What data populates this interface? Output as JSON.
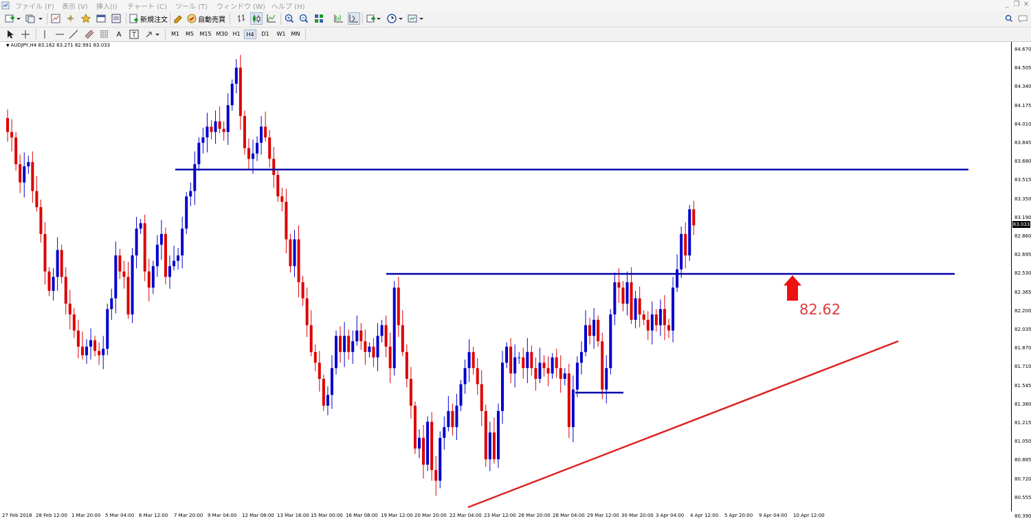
{
  "menu": {
    "items": [
      "ファイル (F)",
      "表示 (V)",
      "挿入(I)",
      "チャート (C)",
      "ツール (T)",
      "ウィンドウ (W)",
      "ヘルプ (H)"
    ]
  },
  "toolbar": {
    "new_order_label": "新規注文",
    "auto_trade_label": "自動売買",
    "timeframes": [
      "M1",
      "M5",
      "M15",
      "M30",
      "H1",
      "H4",
      "D1",
      "W1",
      "MN"
    ],
    "active_timeframe": "H4"
  },
  "chart": {
    "symbol_info": "AUDJPY,H4  83.162 83.271 82.991 83.033",
    "current_price": "83.033",
    "price_labels": [
      "84.670",
      "84.505",
      "84.340",
      "84.175",
      "84.010",
      "83.845",
      "83.680",
      "83.515",
      "83.350",
      "83.190",
      "82.860",
      "82.695",
      "82.530",
      "82.365",
      "82.200",
      "82.035",
      "81.870",
      "81.710",
      "81.545",
      "81.380",
      "81.215",
      "81.050",
      "80.885",
      "80.720",
      "80.555",
      "80.390"
    ],
    "time_labels": [
      "27 Feb 2018",
      "28 Feb 12:00",
      "1 Mar 20:00",
      "5 Mar 04:00",
      "6 Mar 12:00",
      "7 Mar 20:00",
      "9 Mar 04:00",
      "12 Mar 08:00",
      "13 Mar 16:00",
      "15 Mar 00:00",
      "16 Mar 08:00",
      "19 Mar 12:00",
      "20 Mar 20:00",
      "22 Mar 04:00",
      "23 Mar 12:00",
      "26 Mar 20:00",
      "28 Mar 04:00",
      "29 Mar 12:00",
      "30 Mar 20:00",
      "3 Apr 04:00",
      "4 Apr 12:00",
      "5 Apr 20:00",
      "9 Apr 04:00",
      "10 Apr 12:00"
    ],
    "annotation_label": "82.62",
    "colors": {
      "bull": "#0000cc",
      "bear": "#dd0000",
      "line_blue": "#0000aa",
      "line_red": "#dd2222",
      "arrow": "#ee1111"
    }
  },
  "chart_data": {
    "type": "candlestick",
    "symbol": "AUDJPY",
    "timeframe": "H4",
    "ohlc_last": {
      "open": 83.162,
      "high": 83.271,
      "low": 82.991,
      "close": 83.033
    },
    "ylim": [
      80.39,
      84.67
    ],
    "close_path": [
      84.03,
      83.9,
      83.85,
      83.6,
      83.43,
      83.58,
      83.62,
      83.35,
      83.2,
      82.95,
      82.6,
      82.42,
      82.55,
      82.8,
      82.55,
      82.3,
      82.2,
      82.05,
      81.9,
      81.82,
      81.9,
      81.96,
      81.86,
      81.82,
      81.88,
      82.25,
      82.35,
      82.75,
      82.6,
      82.55,
      82.2,
      82.75,
      83.0,
      83.05,
      82.6,
      82.45,
      82.65,
      82.85,
      82.95,
      82.55,
      82.65,
      82.7,
      82.75,
      83.0,
      83.3,
      83.35,
      83.6,
      83.8,
      83.85,
      83.95,
      83.9,
      84.0,
      83.93,
      83.9,
      84.15,
      84.35,
      84.5,
      84.05,
      83.75,
      83.65,
      83.7,
      83.8,
      83.95,
      83.85,
      83.65,
      83.5,
      83.3,
      83.25,
      82.9,
      82.65,
      82.9,
      82.5,
      82.35,
      82.1,
      81.85,
      81.75,
      81.6,
      81.35,
      81.45,
      81.7,
      82.0,
      81.85,
      82.0,
      81.85,
      81.95,
      82.05,
      81.95,
      81.85,
      81.9,
      81.8,
      82.0,
      82.1,
      81.9,
      81.7,
      82.45,
      82.1,
      81.85,
      81.6,
      81.35,
      80.95,
      81.05,
      80.8,
      81.2,
      80.75,
      80.65,
      81.05,
      81.15,
      81.3,
      81.15,
      81.35,
      81.55,
      81.7,
      81.85,
      81.7,
      81.55,
      81.3,
      80.85,
      81.1,
      80.85,
      81.3,
      81.75,
      81.9,
      81.65,
      81.8,
      81.8,
      81.7,
      81.85,
      81.7,
      81.6,
      81.75,
      81.7,
      81.65,
      81.8,
      81.7,
      81.6,
      81.65,
      81.15,
      81.5,
      81.75,
      81.85,
      82.1,
      82.0,
      82.15,
      81.95,
      81.5,
      81.7,
      82.2,
      82.5,
      82.45,
      82.3,
      82.5,
      82.15,
      82.35,
      82.2,
      82.15,
      82.05,
      82.2,
      82.1,
      82.25,
      82.1,
      82.05,
      82.45,
      82.62,
      82.95,
      82.75,
      83.18,
      83.03
    ],
    "horizontal_lines": [
      {
        "price": 83.56,
        "color": "blue",
        "from": "7 Mar 20:00",
        "to": "10 Apr 12:00"
      },
      {
        "price": 82.62,
        "color": "blue",
        "from": "19 Mar 12:00",
        "to": "10 Apr 12:00"
      },
      {
        "price": 81.49,
        "color": "blue",
        "from": "28 Mar 04:00",
        "to": "29 Mar 12:00"
      }
    ],
    "trendline": {
      "color": "red",
      "from_price": 80.47,
      "to_price": 82.08
    },
    "annotation": {
      "label": "82.62",
      "marker": "red up arrow"
    }
  }
}
